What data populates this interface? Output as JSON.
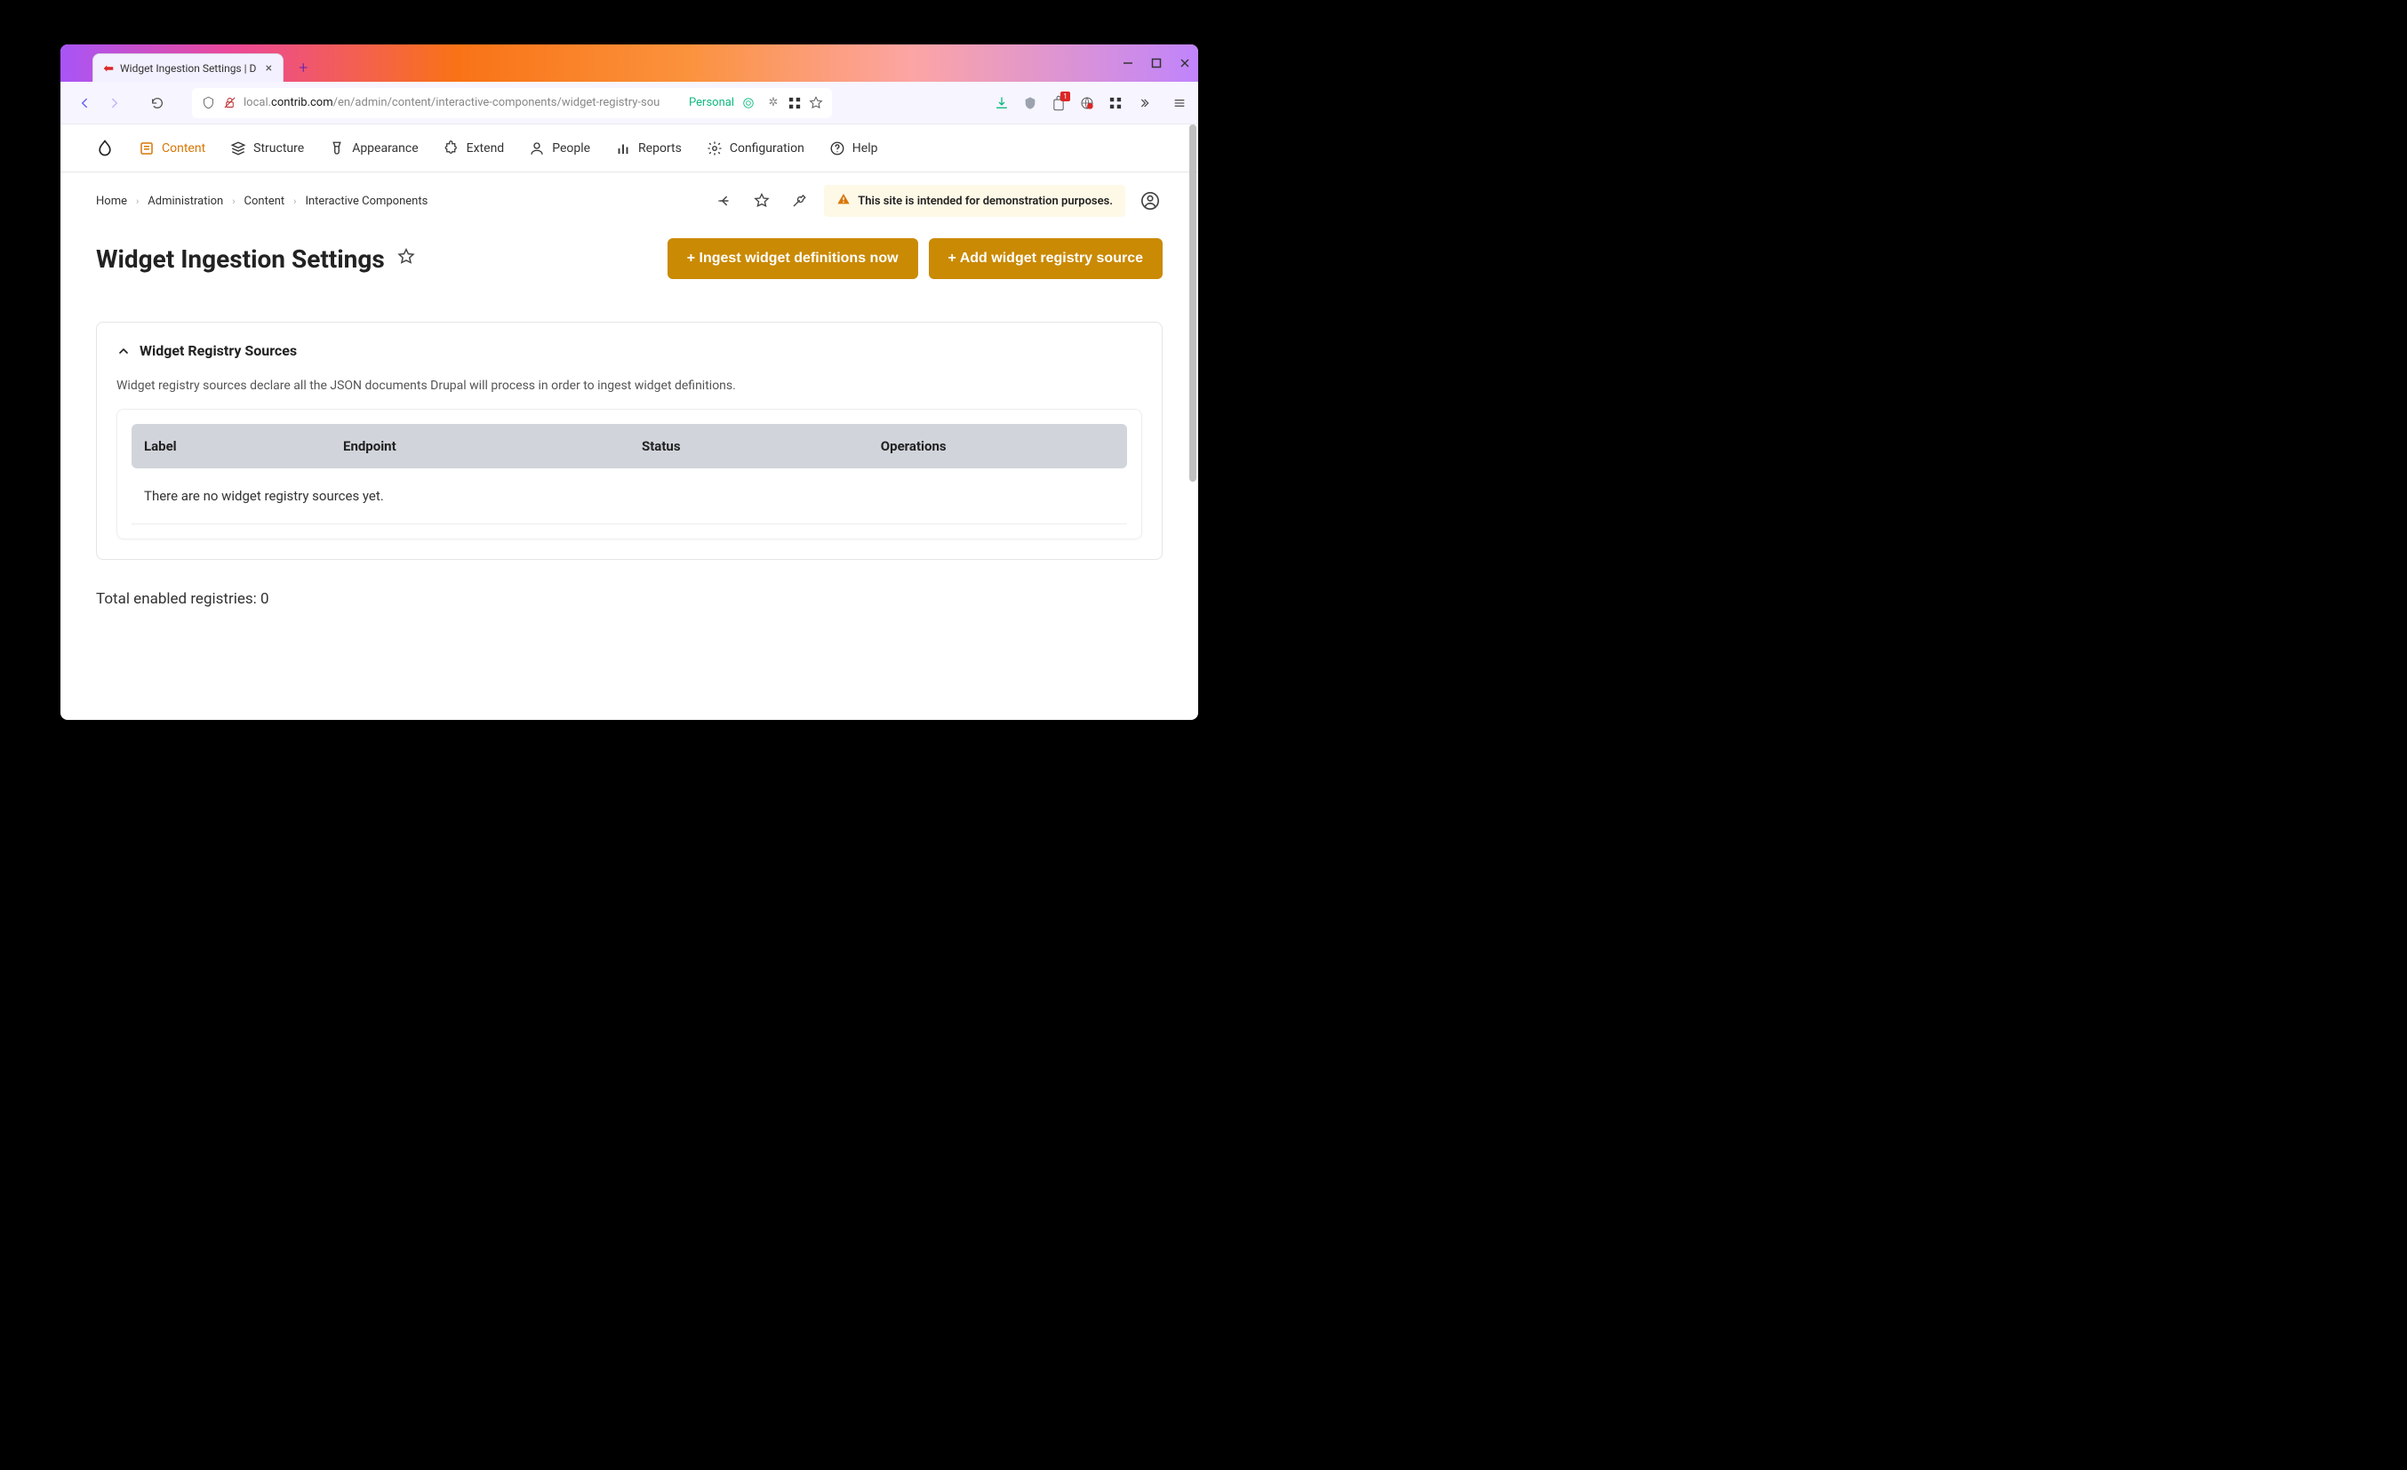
{
  "browser": {
    "tab_title": "Widget Ingestion Settings | D",
    "url_prefix": "local.",
    "url_domain": "contrib.com",
    "url_path": "/en/admin/content/interactive-components/widget-registry-sou",
    "container_label": "Personal",
    "ext_badge": "1"
  },
  "admin_nav": [
    {
      "label": "Content",
      "active": true
    },
    {
      "label": "Structure"
    },
    {
      "label": "Appearance"
    },
    {
      "label": "Extend"
    },
    {
      "label": "People"
    },
    {
      "label": "Reports"
    },
    {
      "label": "Configuration"
    },
    {
      "label": "Help"
    }
  ],
  "breadcrumb": [
    "Home",
    "Administration",
    "Content",
    "Interactive Components"
  ],
  "demo_message": "This site is intended for demonstration purposes.",
  "page_title": "Widget Ingestion Settings",
  "buttons": {
    "ingest": "+ Ingest widget definitions now",
    "add_source": "+ Add widget registry source"
  },
  "section": {
    "title": "Widget Registry Sources",
    "description": "Widget registry sources declare all the JSON documents Drupal will process in order to ingest widget definitions.",
    "columns": [
      "Label",
      "Endpoint",
      "Status",
      "Operations"
    ],
    "empty_message": "There are no widget registry sources yet."
  },
  "footer": "Total enabled registries: 0"
}
